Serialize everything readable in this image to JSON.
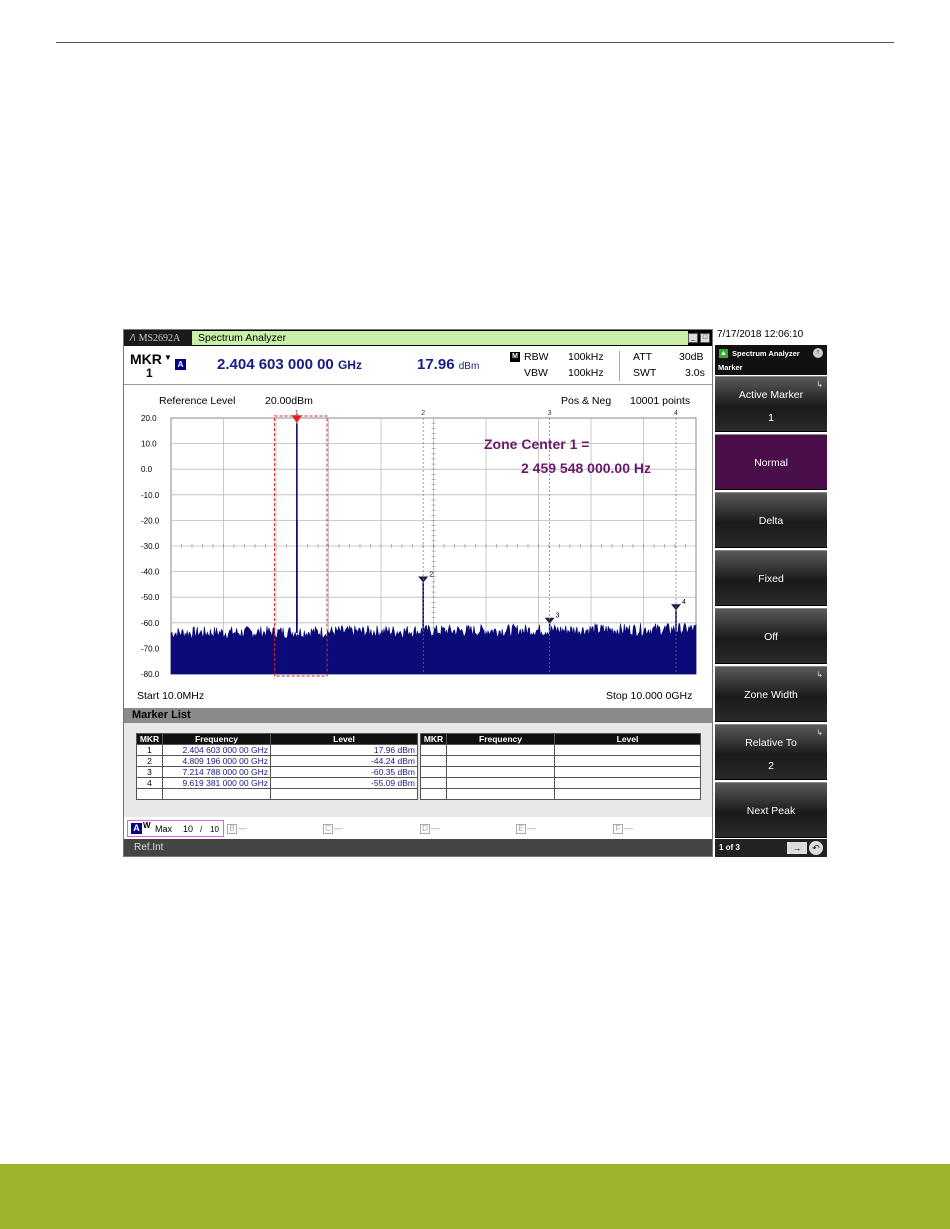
{
  "window": {
    "logo": "MS2692A",
    "title": "Spectrum Analyzer",
    "win_buttons": [
      "_",
      "□"
    ]
  },
  "marker_readout": {
    "label": "MKR",
    "marker_number": "1",
    "trace_badge": "A",
    "frequency": "2.404 603 000 00",
    "frequency_unit": "GHz",
    "level": "17.96",
    "level_unit": "dBm",
    "mode_badge": "M",
    "rbw_label": "RBW",
    "rbw_value": "100kHz",
    "vbw_label": "VBW",
    "vbw_value": "100kHz",
    "att_label": "ATT",
    "att_value": "30dB",
    "swt_label": "SWT",
    "swt_value": "3.0s"
  },
  "graph_header": {
    "ref_level_label": "Reference Level",
    "ref_level_value": "20.00dBm",
    "detection": "Pos & Neg",
    "points": "10001 points"
  },
  "annotation": {
    "line1": "Zone Center 1 =",
    "line2": "2 459 548 000.00 Hz"
  },
  "chart_data": {
    "type": "line",
    "title": "",
    "xlabel": "",
    "ylabel": "",
    "x_range_ghz": [
      0.01,
      10.0
    ],
    "y_range_dbm": [
      -80,
      20
    ],
    "y_ticks": [
      "20.0",
      "10.0",
      "0.0",
      "-10.0",
      "-20.0",
      "-30.0",
      "-40.0",
      "-50.0",
      "-60.0",
      "-70.0",
      "-80.0"
    ],
    "start_label": "Start 10.0MHz",
    "stop_label": "Stop 10.000 0GHz",
    "noise_floor_dbm": -64,
    "peaks": [
      {
        "marker": "1",
        "freq_ghz": 2.4046,
        "level_dbm": 17.96
      },
      {
        "marker": "",
        "freq_ghz": 2.4046,
        "level_dbm": -20
      },
      {
        "marker": "2",
        "freq_ghz": 4.8092,
        "level_dbm": -44.24
      },
      {
        "marker": "3",
        "freq_ghz": 7.2148,
        "level_dbm": -60.35
      },
      {
        "marker": "4",
        "freq_ghz": 9.6194,
        "level_dbm": -55.09
      }
    ],
    "top_marker_labels": [
      "1",
      "2",
      "3",
      "4"
    ],
    "zone_freq_range_ghz": [
      1.98,
      2.98
    ],
    "grid": true
  },
  "marker_list": {
    "title": "Marker List",
    "headers": [
      "MKR",
      "Frequency",
      "Level"
    ],
    "rows": [
      {
        "mkr": "1",
        "frequency": "2.404 603 000 00 GHz",
        "level": "17.96  dBm"
      },
      {
        "mkr": "2",
        "frequency": "4.809 196 000 00 GHz",
        "level": "-44.24  dBm"
      },
      {
        "mkr": "3",
        "frequency": "7.214 788 000 00 GHz",
        "level": "-60.35  dBm"
      },
      {
        "mkr": "4",
        "frequency": "9.619 381 000 00 GHz",
        "level": "-55.09  dBm"
      }
    ]
  },
  "trace_bar": {
    "active": {
      "letter": "A",
      "w": "W",
      "mode": "Max",
      "count": "10",
      "slash": "/",
      "total": "10"
    },
    "others": [
      {
        "letter": "B",
        "dash": "—"
      },
      {
        "letter": "C",
        "dash": "—"
      },
      {
        "letter": "D",
        "dash": "—"
      },
      {
        "letter": "E",
        "dash": "—"
      },
      {
        "letter": "F",
        "dash": "—"
      }
    ]
  },
  "status": {
    "ref": "Ref.Int"
  },
  "side_panel": {
    "datetime": "7/17/2018 12:06:10",
    "header_title": "Spectrum Analyzer",
    "header_sub": "Marker",
    "softkeys": [
      {
        "label": "Active Marker",
        "value": "1",
        "arrow": "↳"
      },
      {
        "label": "Normal",
        "value": "",
        "arrow": ""
      },
      {
        "label": "Delta",
        "value": "",
        "arrow": ""
      },
      {
        "label": "Fixed",
        "value": "",
        "arrow": ""
      },
      {
        "label": "Off",
        "value": "",
        "arrow": ""
      },
      {
        "label": "Zone Width",
        "value": "",
        "arrow": "↳"
      },
      {
        "label": "Relative To",
        "value": "2",
        "arrow": "↳"
      },
      {
        "label": "Next Peak",
        "value": "",
        "arrow": ""
      }
    ],
    "page": "1 of 3",
    "nav_next": "→",
    "nav_back": "↶"
  },
  "colors": {
    "trace": "#0a0a78",
    "zone_box": "#e02020",
    "annotation": "#6a1a6a",
    "softkey_active": "#4a0f4a",
    "footer_bar": "#9cb52c"
  }
}
